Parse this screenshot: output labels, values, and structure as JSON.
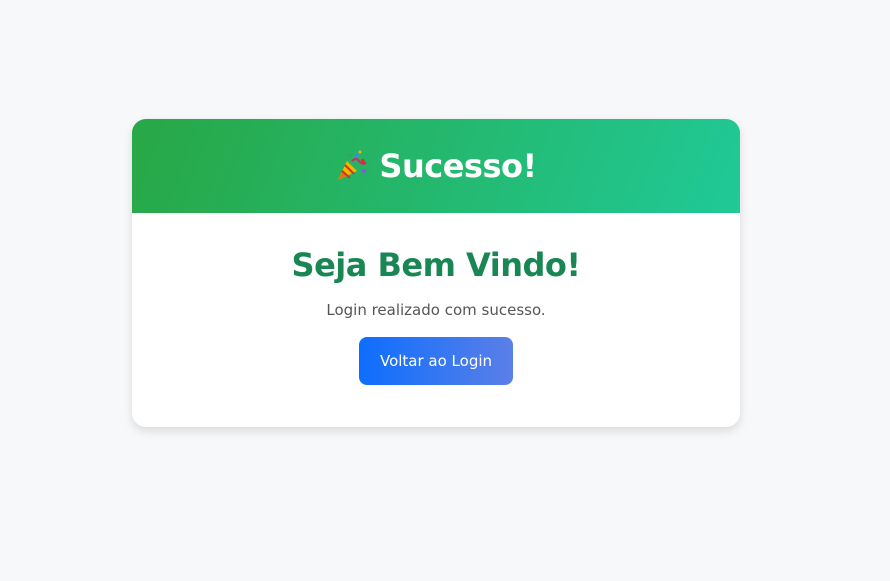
{
  "header": {
    "icon": "party-popper-icon",
    "title": "Sucesso!"
  },
  "body": {
    "heading": "Seja Bem Vindo!",
    "message": "Login realizado com sucesso.",
    "button_label": "Voltar ao Login"
  },
  "colors": {
    "header_gradient_start": "#28a745",
    "header_gradient_end": "#20c997",
    "heading": "#198754",
    "button_gradient_start": "#0d6efd",
    "button_gradient_end": "#5b7fe8"
  }
}
